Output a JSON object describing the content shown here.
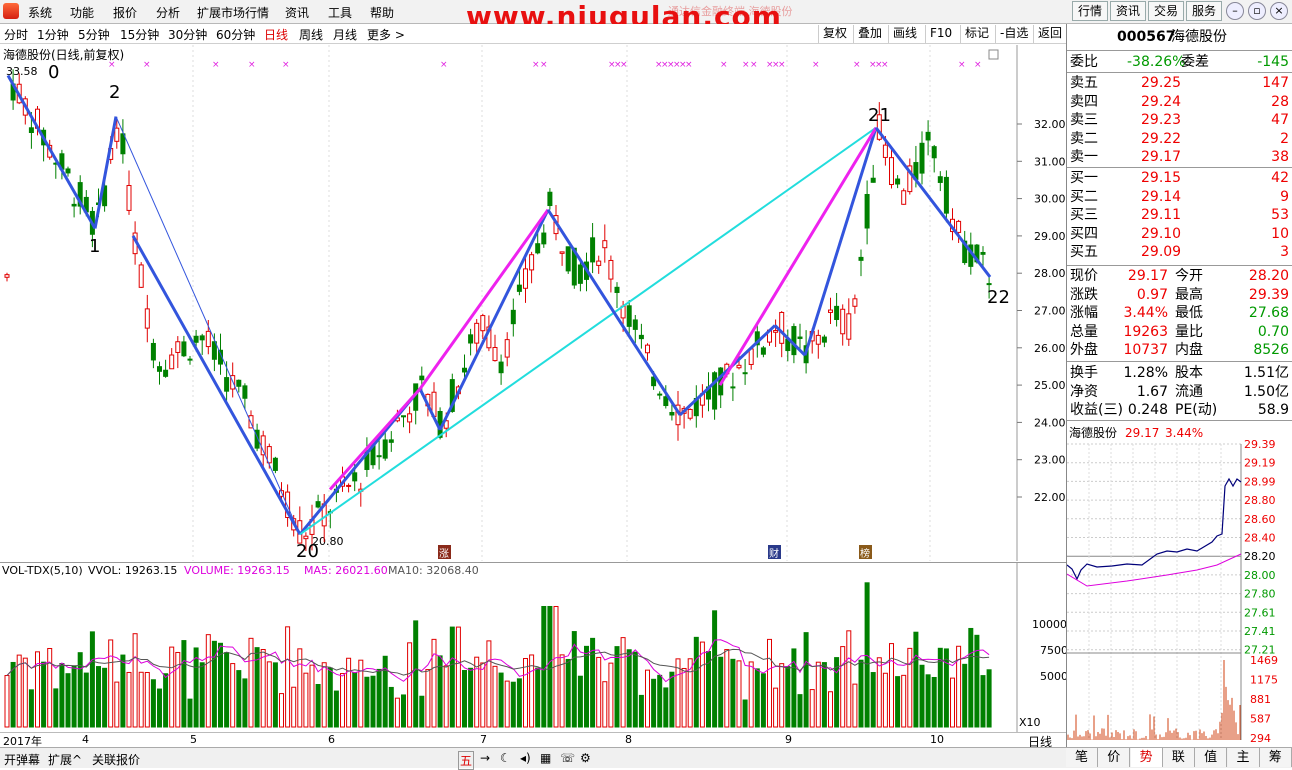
{
  "menubar": {
    "items": [
      "系统",
      "功能",
      "报价",
      "分析",
      "扩展市场行情",
      "资讯",
      "工具",
      "帮助"
    ],
    "watermark": "www.niugulan.com",
    "title_behind": "通达信金融终端  海德股份",
    "right_buttons": [
      "行情",
      "资讯",
      "交易",
      "服务"
    ]
  },
  "periodbar": {
    "periods": [
      "分时",
      "1分钟",
      "5分钟",
      "15分钟",
      "30分钟",
      "60分钟",
      "日线",
      "周线",
      "月线",
      "更多 >"
    ],
    "active": "日线",
    "tools": [
      "复权",
      "叠加",
      "画线",
      "F10",
      "标记",
      "-自选",
      "返回"
    ]
  },
  "main_chart": {
    "title": "海德股份(日线,前复权)",
    "high_label": "33.58",
    "low_label": "20.80",
    "price_ticks": [
      "32.00",
      "31.00",
      "30.00",
      "29.00",
      "28.00",
      "27.00",
      "26.00",
      "25.00",
      "24.00",
      "23.00",
      "22.00"
    ],
    "wave_labels": [
      "0",
      "2",
      "1",
      "20",
      "21",
      "22"
    ],
    "event_markers": [
      "涨",
      "财",
      "榜"
    ]
  },
  "vol_chart": {
    "title": "VOL-TDX(5,10)",
    "vvol_label": "VVOL: 19263.15",
    "volume_label": "VOLUME: 19263.15",
    "ma5_label": "MA5: 26021.60",
    "ma10_label": "MA10: 32068.40",
    "ticks": [
      "10000",
      "7500",
      "5000"
    ],
    "unit": "X10"
  },
  "date_axis": {
    "labels": [
      "2017年",
      "4",
      "5",
      "6",
      "7",
      "8",
      "9",
      "10"
    ],
    "period": "日线"
  },
  "statusbar": {
    "items": [
      "开弹幕",
      "扩展^",
      "关联报价"
    ]
  },
  "quote": {
    "code": "000567",
    "name": "海德股份",
    "weibi_label": "委比",
    "weibi": "-38.26%",
    "weicha_label": "委差",
    "weicha": "-145",
    "asks": [
      {
        "label": "卖五",
        "price": "29.25",
        "vol": "147"
      },
      {
        "label": "卖四",
        "price": "29.24",
        "vol": "28"
      },
      {
        "label": "卖三",
        "price": "29.23",
        "vol": "47"
      },
      {
        "label": "卖二",
        "price": "29.22",
        "vol": "2"
      },
      {
        "label": "卖一",
        "price": "29.17",
        "vol": "38"
      }
    ],
    "bids": [
      {
        "label": "买一",
        "price": "29.15",
        "vol": "42"
      },
      {
        "label": "买二",
        "price": "29.14",
        "vol": "9"
      },
      {
        "label": "买三",
        "price": "29.11",
        "vol": "53"
      },
      {
        "label": "买四",
        "price": "29.10",
        "vol": "10"
      },
      {
        "label": "买五",
        "price": "29.09",
        "vol": "3"
      }
    ],
    "stats": [
      {
        "l1": "现价",
        "v1": "29.17",
        "l2": "今开",
        "v2": "28.20"
      },
      {
        "l1": "涨跌",
        "v1": "0.97",
        "l2": "最高",
        "v2": "29.39"
      },
      {
        "l1": "涨幅",
        "v1": "3.44%",
        "l2": "最低",
        "v2": "27.68"
      },
      {
        "l1": "总量",
        "v1": "19263",
        "l2": "量比",
        "v2": "0.70"
      },
      {
        "l1": "外盘",
        "v1": "10737",
        "l2": "内盘",
        "v2": "8526"
      }
    ],
    "stats2": [
      {
        "l1": "换手",
        "v1": "1.28%",
        "l2": "股本",
        "v2": "1.51亿"
      },
      {
        "l1": "净资",
        "v1": "1.67",
        "l2": "流通",
        "v2": "1.50亿"
      },
      {
        "l1": "收益(三)",
        "v1": "0.248",
        "l2": "PE(动)",
        "v2": "58.9"
      }
    ]
  },
  "mini_chart": {
    "title": "海德股份",
    "price": "29.17",
    "pct": "3.44%",
    "ticks": [
      "29.39",
      "29.19",
      "28.99",
      "28.80",
      "28.60",
      "28.40",
      "28.20",
      "28.00",
      "27.80",
      "27.61",
      "27.41",
      "27.21"
    ],
    "vol_ticks": [
      "1469",
      "1175",
      "881",
      "587",
      "294"
    ]
  },
  "bottom_tabs": [
    "笔",
    "价",
    "势",
    "联",
    "值",
    "主",
    "筹"
  ],
  "bottom_active": "势",
  "colors": {
    "up": "#e00000",
    "down": "#008000",
    "wave_blue": "#3355dd",
    "wave_magenta": "#ee22ee",
    "wave_cyan": "#22dddd"
  },
  "icons": [
    "app-logo-icon",
    "minimize-icon",
    "restore-icon",
    "close-icon",
    "chart-settings-icon"
  ]
}
